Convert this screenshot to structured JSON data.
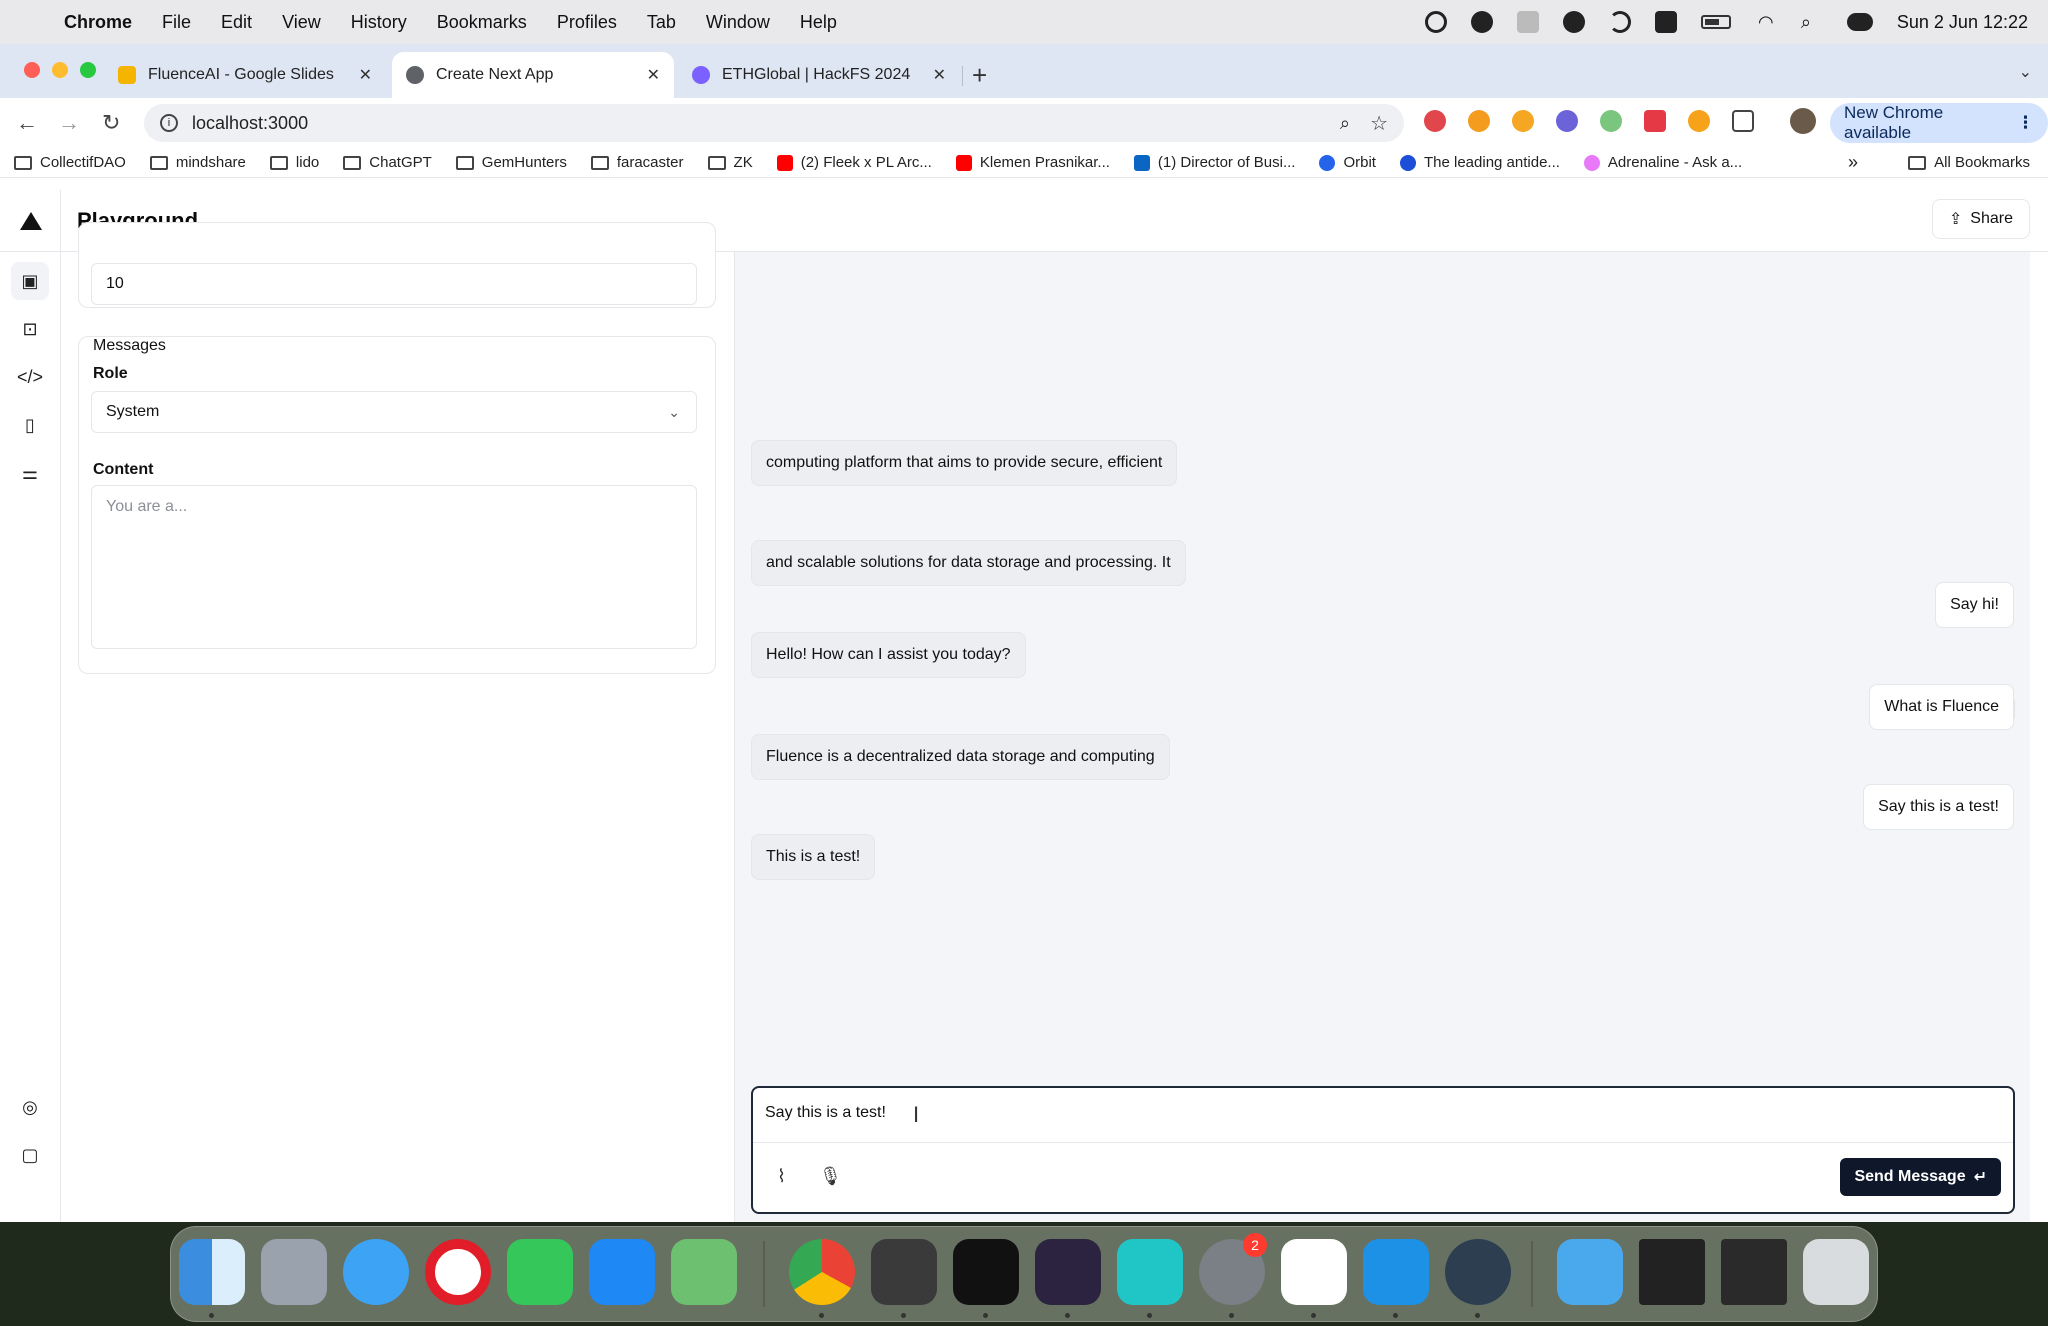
{
  "menubar": {
    "app": "Chrome",
    "items": [
      "File",
      "Edit",
      "View",
      "History",
      "Bookmarks",
      "Profiles",
      "Tab",
      "Window",
      "Help"
    ],
    "clock": "Sun 2 Jun  12:22"
  },
  "tabs": [
    {
      "title": "FluenceAI - Google Slides",
      "favicon_color": "#f4b400",
      "close": "✕"
    },
    {
      "title": "Create Next App",
      "favicon_color": "#5f6368",
      "close": "✕"
    },
    {
      "title": "ETHGlobal | HackFS 2024",
      "favicon_color": "#7b61ff",
      "close": "✕"
    }
  ],
  "toolbar": {
    "url": "localhost:3000",
    "update_label": "New Chrome available"
  },
  "bookmarks": [
    {
      "label": "CollectifDAO",
      "type": "folder"
    },
    {
      "label": "mindshare",
      "type": "folder"
    },
    {
      "label": "lido",
      "type": "folder"
    },
    {
      "label": "ChatGPT",
      "type": "folder"
    },
    {
      "label": "GemHunters",
      "type": "folder"
    },
    {
      "label": "faracaster",
      "type": "folder"
    },
    {
      "label": "ZK",
      "type": "folder"
    },
    {
      "label": "(2) Fleek x PL Arc...",
      "type": "youtube"
    },
    {
      "label": "Klemen Prasnikar...",
      "type": "youtube"
    },
    {
      "label": "(1) Director of Busi...",
      "type": "linkedin"
    },
    {
      "label": "Orbit",
      "type": "site"
    },
    {
      "label": "The leading antide...",
      "type": "site"
    },
    {
      "label": "Adrenaline - Ask a...",
      "type": "site"
    }
  ],
  "bookmarks_all": "All Bookmarks",
  "app": {
    "title": "Playground",
    "share_label": "Share",
    "settings": {
      "number_value": "10",
      "messages_heading": "Messages",
      "role_label": "Role",
      "role_value": "System",
      "content_label": "Content",
      "content_placeholder": "You are a..."
    },
    "chat": [
      {
        "role": "assistant",
        "text": "computing platform that aims to provide secure, efficient"
      },
      {
        "role": "assistant",
        "text": "and scalable solutions for data storage and processing. It"
      },
      {
        "role": "user",
        "text": "Say hi!"
      },
      {
        "role": "assistant",
        "text": "Hello! How can I assist you today?"
      },
      {
        "role": "user",
        "text": "What is Fluence"
      },
      {
        "role": "assistant",
        "text": "Fluence is a decentralized data storage and computing"
      },
      {
        "role": "user",
        "text": "Say this is a test!"
      },
      {
        "role": "assistant",
        "text": "This is a test!"
      }
    ],
    "composer": {
      "value": "Say this is a test!",
      "send_label": "Send Message"
    }
  },
  "dock_badge": "2"
}
